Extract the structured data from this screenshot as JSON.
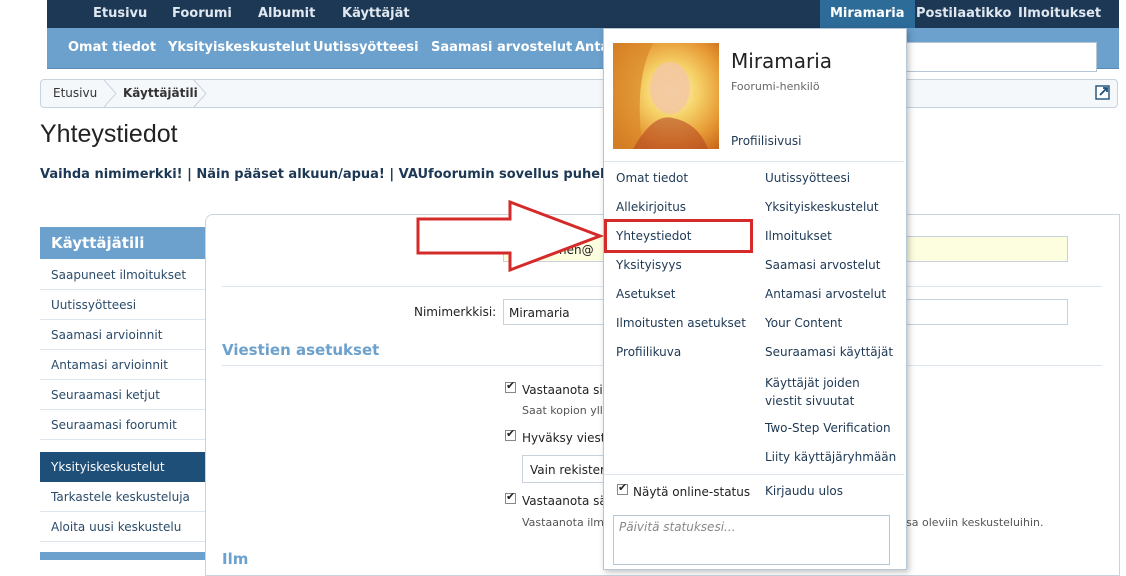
{
  "topnav": {
    "items": [
      "Etusivu",
      "Foorumi",
      "Albumit",
      "Käyttäjät"
    ],
    "active": "Miramaria",
    "right": [
      "Postilaatikko",
      "Ilmoitukset"
    ]
  },
  "subnav": {
    "items": [
      "Omat tiedot",
      "Yksityiskeskustelut",
      "Uutissyötteesi",
      "Saamasi arvostelut",
      "Anta"
    ]
  },
  "breadcrumb": {
    "items": [
      "Etusivu",
      "Käyttäjätili"
    ]
  },
  "page": {
    "title": "Yhteystiedot",
    "links": "Vaihda nimimerkki! | Näin pääset alkuun/apua! | VAUfoorumin sovellus puhelimeen! | Top"
  },
  "sidebar": {
    "head1": "Käyttäjätili",
    "items1": [
      "Saapuneet ilmoitukset",
      "Uutissyötteesi",
      "Saamasi arvioinnit",
      "Antamasi arvioinnit",
      "Seuraamasi ketjut",
      "Seuraamasi foorumit"
    ],
    "head2": "Yksityiskeskustelut",
    "items2": [
      "Tarkastele keskusteluja",
      "Aloita uusi keskustelu"
    ]
  },
  "form": {
    "email_partial": "nen@",
    "nick_label": "Nimimerkkisi:",
    "nick_value": "Miramaria",
    "section1": "Viestien asetukset",
    "opt1": "Vastaanota siv",
    "opt1_hint": "Saat kopion yll",
    "opt2": "Hyväksy viestit",
    "select_value": "Vain rekister",
    "opt3": "Vastaanota sä",
    "opt3_hint": "Vastaanota ilm",
    "opt3_hint_right": "sa oleviin keskusteluihin.",
    "section2": "Ilm"
  },
  "menu": {
    "name": "Miramaria",
    "role": "Foorumi-henkilö",
    "profile_link": "Profiilisivusi",
    "left": [
      "Omat tiedot",
      "Allekirjoitus",
      "Yhteystiedot",
      "Yksityisyys",
      "Asetukset",
      "Ilmoitusten asetukset",
      "Profiilikuva"
    ],
    "right": [
      "Uutissyötteesi",
      "Yksityiskeskustelut",
      "Ilmoitukset",
      "Saamasi arvostelut",
      "Antamasi arvostelut",
      "Your Content",
      "Seuraamasi käyttäjät",
      "Käyttäjät joiden viestit sivuutat",
      "Two-Step Verification",
      "Liity käyttäjäryhmään"
    ],
    "online_status": "Näytä online-status",
    "logout": "Kirjaudu ulos",
    "status_placeholder": "Päivitä statuksesi..."
  },
  "colors": {
    "dark_nav": "#1d3854",
    "light_nav": "#6ca0cd",
    "highlight": "#d42a2a"
  }
}
